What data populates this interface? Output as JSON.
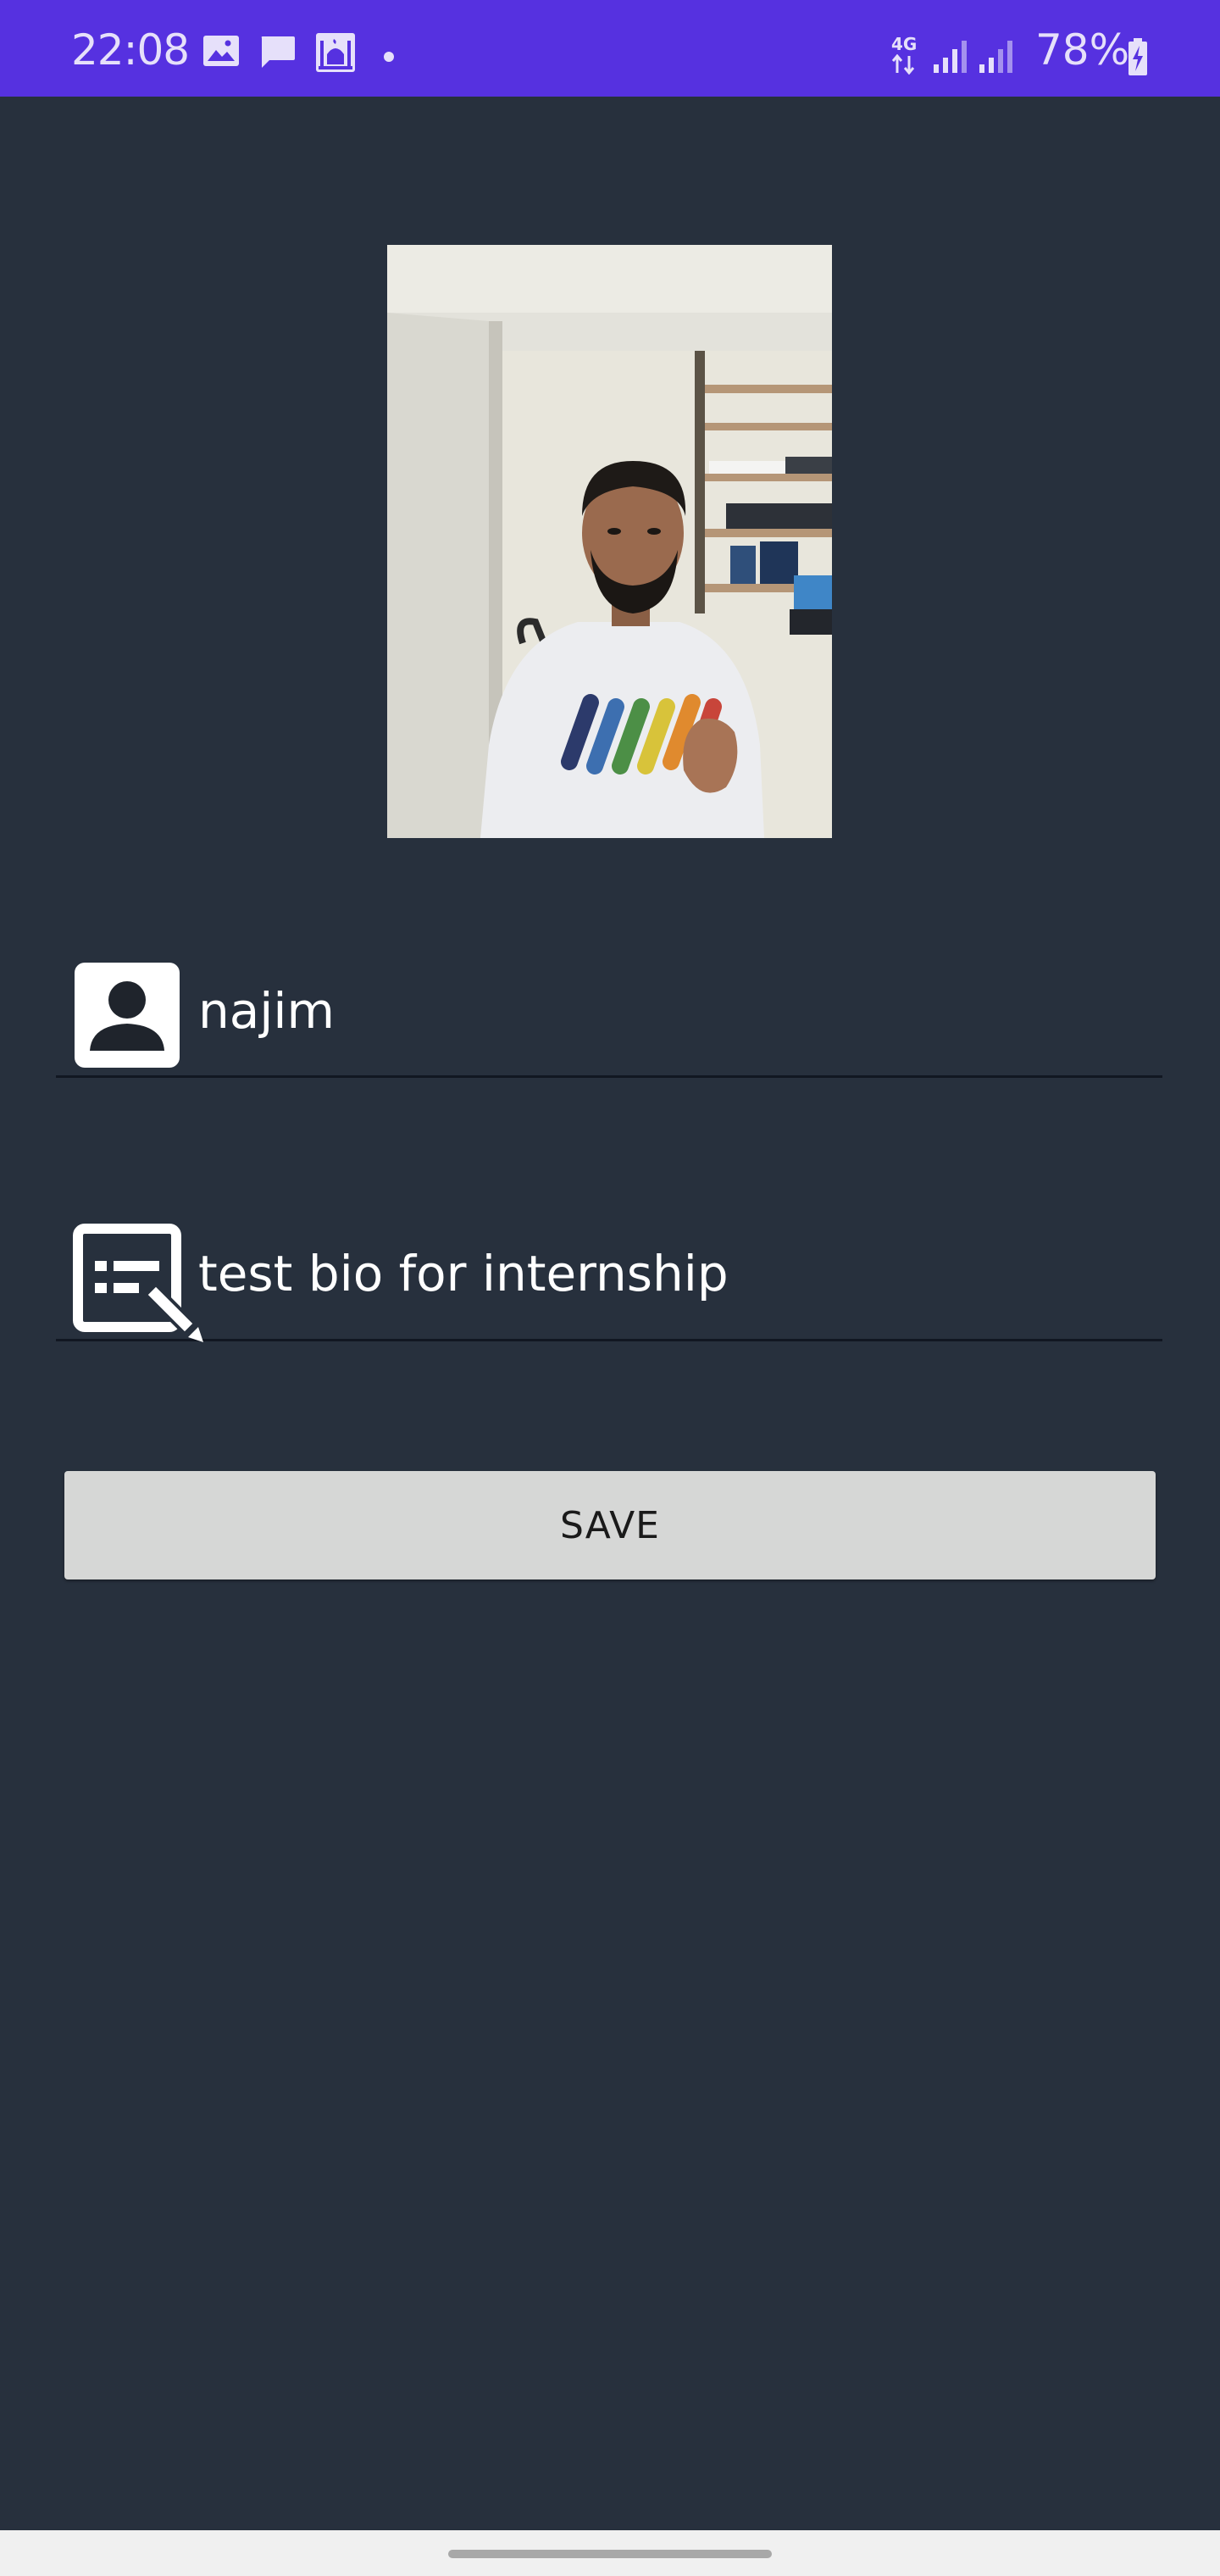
{
  "status_bar": {
    "time": "22:08",
    "network": "4G",
    "battery": "78%",
    "background_color": "#5631e0",
    "icons": [
      "image-icon",
      "message-icon",
      "mosque-icon",
      "dot-icon",
      "network-4g-icon",
      "signal-icon",
      "signal-icon",
      "battery-charging-icon"
    ]
  },
  "profile": {
    "name": "najim",
    "bio": "test bio for internship",
    "name_icon": "person-icon",
    "bio_icon": "edit-note-icon"
  },
  "actions": {
    "save_label": "SAVE"
  },
  "colors": {
    "background": "#27303d",
    "button": "#d6d7d6",
    "text": "#ffffff"
  }
}
